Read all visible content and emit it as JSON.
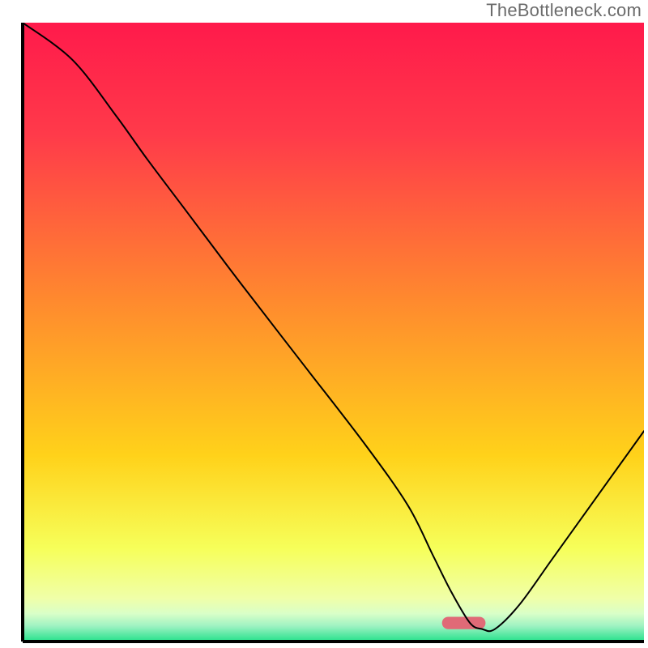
{
  "watermark": "TheBottleneck.com",
  "chart_data": {
    "type": "line",
    "title": "",
    "xlabel": "",
    "ylabel": "",
    "xlim": [
      0,
      100
    ],
    "ylim": [
      0,
      100
    ],
    "grid": false,
    "legend": false,
    "background_gradient": {
      "direction": "vertical",
      "stops": [
        {
          "offset": 0.0,
          "color": "#ff1a4b"
        },
        {
          "offset": 0.18,
          "color": "#ff3a4a"
        },
        {
          "offset": 0.45,
          "color": "#ff8a2e"
        },
        {
          "offset": 0.7,
          "color": "#ffd21a"
        },
        {
          "offset": 0.85,
          "color": "#f6ff5a"
        },
        {
          "offset": 0.93,
          "color": "#f0ffa8"
        },
        {
          "offset": 0.955,
          "color": "#d9ffc8"
        },
        {
          "offset": 0.975,
          "color": "#9ef2c2"
        },
        {
          "offset": 1.0,
          "color": "#24e18b"
        }
      ]
    },
    "marker": {
      "x": 71,
      "y": 3,
      "width": 7,
      "height": 2,
      "color": "#e06a77",
      "rx": 1.2
    },
    "series": [
      {
        "name": "bottleneck-curve",
        "color": "#000000",
        "stroke_width": 2,
        "x": [
          0,
          8,
          15,
          20,
          26,
          35,
          45,
          55,
          62,
          66,
          69,
          72,
          74,
          76,
          80,
          85,
          90,
          95,
          100
        ],
        "values": [
          100,
          94,
          85,
          78,
          70,
          58,
          45,
          32,
          22,
          14,
          8,
          3,
          2,
          2,
          6,
          13,
          20,
          27,
          34
        ]
      }
    ]
  }
}
